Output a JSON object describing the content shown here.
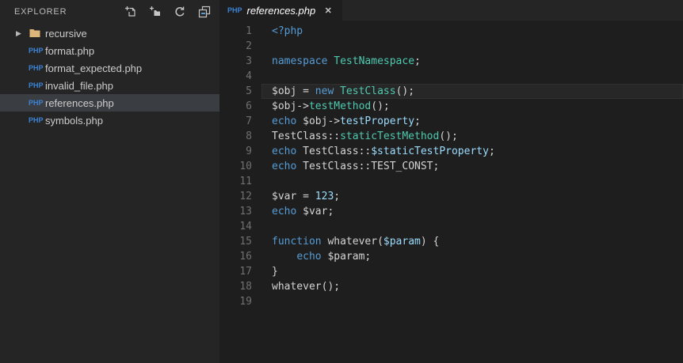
{
  "colors": {
    "kw": "#569CD6",
    "type": "#4EC9B0",
    "prop": "#9CDCFE",
    "num": "#9CDCFE",
    "plain": "#D4D4D4",
    "editor_bg": "#1E1E1E",
    "sidebar_bg": "#252526",
    "selection_bg": "#3A3D41",
    "php_badge_blue": "#3B83D3",
    "folder_tan": "#DCB67A"
  },
  "sidebar": {
    "title": "EXPLORER",
    "actions": [
      {
        "icon": "new-file-icon"
      },
      {
        "icon": "new-folder-icon"
      },
      {
        "icon": "refresh-icon"
      },
      {
        "icon": "collapse-all-icon"
      }
    ],
    "file_badge": "PHP",
    "items": [
      {
        "label": "recursive",
        "type": "folder",
        "selected": false
      },
      {
        "label": "format.php",
        "type": "php",
        "selected": false
      },
      {
        "label": "format_expected.php",
        "type": "php",
        "selected": false
      },
      {
        "label": "invalid_file.php",
        "type": "php",
        "selected": false
      },
      {
        "label": "references.php",
        "type": "php",
        "selected": true
      },
      {
        "label": "symbols.php",
        "type": "php",
        "selected": false
      }
    ]
  },
  "tab": {
    "label": "references.php",
    "badge": "PHP",
    "close_glyph": "✕"
  },
  "editor": {
    "current_line": 5,
    "lines": [
      {
        "n": 1,
        "tokens": [
          {
            "t": "<?php",
            "c": "kw"
          }
        ]
      },
      {
        "n": 2,
        "tokens": []
      },
      {
        "n": 3,
        "tokens": [
          {
            "t": "namespace",
            "c": "kw"
          },
          {
            "t": " ",
            "c": "plain"
          },
          {
            "t": "TestNamespace",
            "c": "type"
          },
          {
            "t": ";",
            "c": "plain"
          }
        ]
      },
      {
        "n": 4,
        "tokens": []
      },
      {
        "n": 5,
        "tokens": [
          {
            "t": "$obj = ",
            "c": "plain"
          },
          {
            "t": "new",
            "c": "kw"
          },
          {
            "t": " ",
            "c": "plain"
          },
          {
            "t": "TestClass",
            "c": "type"
          },
          {
            "t": "();",
            "c": "plain"
          }
        ]
      },
      {
        "n": 6,
        "tokens": [
          {
            "t": "$obj->",
            "c": "plain"
          },
          {
            "t": "testMethod",
            "c": "type"
          },
          {
            "t": "();",
            "c": "plain"
          }
        ]
      },
      {
        "n": 7,
        "tokens": [
          {
            "t": "echo",
            "c": "kw"
          },
          {
            "t": " $obj->",
            "c": "plain"
          },
          {
            "t": "testProperty",
            "c": "prop"
          },
          {
            "t": ";",
            "c": "plain"
          }
        ]
      },
      {
        "n": 8,
        "tokens": [
          {
            "t": "TestClass::",
            "c": "plain"
          },
          {
            "t": "staticTestMethod",
            "c": "type"
          },
          {
            "t": "();",
            "c": "plain"
          }
        ]
      },
      {
        "n": 9,
        "tokens": [
          {
            "t": "echo",
            "c": "kw"
          },
          {
            "t": " TestClass::",
            "c": "plain"
          },
          {
            "t": "$staticTestProperty",
            "c": "prop"
          },
          {
            "t": ";",
            "c": "plain"
          }
        ]
      },
      {
        "n": 10,
        "tokens": [
          {
            "t": "echo",
            "c": "kw"
          },
          {
            "t": " TestClass::TEST_CONST;",
            "c": "plain"
          }
        ]
      },
      {
        "n": 11,
        "tokens": []
      },
      {
        "n": 12,
        "tokens": [
          {
            "t": "$var = ",
            "c": "plain"
          },
          {
            "t": "123",
            "c": "num"
          },
          {
            "t": ";",
            "c": "plain"
          }
        ]
      },
      {
        "n": 13,
        "tokens": [
          {
            "t": "echo",
            "c": "kw"
          },
          {
            "t": " $var;",
            "c": "plain"
          }
        ]
      },
      {
        "n": 14,
        "tokens": []
      },
      {
        "n": 15,
        "tokens": [
          {
            "t": "function",
            "c": "kw"
          },
          {
            "t": " whatever(",
            "c": "plain"
          },
          {
            "t": "$param",
            "c": "prop"
          },
          {
            "t": ") {",
            "c": "plain"
          }
        ]
      },
      {
        "n": 16,
        "tokens": [
          {
            "t": "    ",
            "c": "plain"
          },
          {
            "t": "echo",
            "c": "kw"
          },
          {
            "t": " $param;",
            "c": "plain"
          }
        ]
      },
      {
        "n": 17,
        "tokens": [
          {
            "t": "}",
            "c": "plain"
          }
        ]
      },
      {
        "n": 18,
        "tokens": [
          {
            "t": "whatever();",
            "c": "plain"
          }
        ]
      },
      {
        "n": 19,
        "tokens": []
      }
    ]
  }
}
